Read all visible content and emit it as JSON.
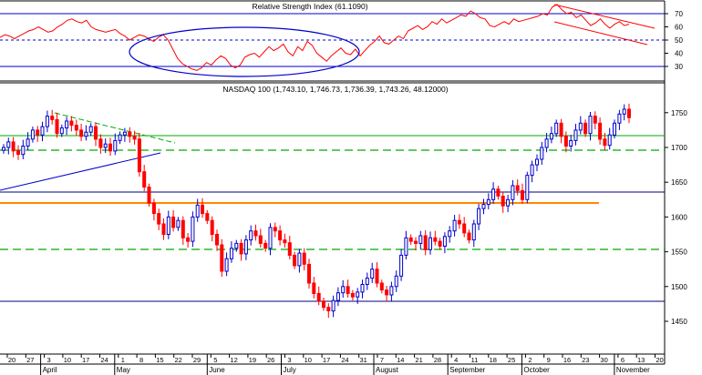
{
  "rsi_panel": {
    "title": "Relative Strength Index (61.1090)",
    "y_ticks": [
      "70",
      "60",
      "50",
      "40",
      "30"
    ],
    "colors": {
      "line": "#ff0000",
      "band": "#0000cc",
      "ellipse": "#0000cc",
      "channel": "#ff0000"
    }
  },
  "price_panel": {
    "title": "NASDAQ 100 (1,743.10, 1,746.73, 1,736.39, 1,743.26, 48.12000)",
    "y_ticks": [
      "1750",
      "1700",
      "1650",
      "1600",
      "1550",
      "1500",
      "1450"
    ],
    "colors": {
      "up_candle": "#0000cc",
      "down_candle": "#ff0000",
      "green_line": "#00aa00",
      "orange_line": "#ff8800",
      "navy_line": "#000080",
      "trendline": "#0000cc"
    }
  },
  "x_axis": {
    "day_labels": [
      "20",
      "27",
      "3",
      "10",
      "17",
      "24",
      "1",
      "8",
      "15",
      "22",
      "29",
      "5",
      "12",
      "19",
      "26",
      "3",
      "10",
      "17",
      "24",
      "31",
      "7",
      "14",
      "21",
      "28",
      "4",
      "11",
      "18",
      "25",
      "2",
      "9",
      "16",
      "23",
      "30",
      "6",
      "13",
      "20"
    ],
    "month_labels": [
      "April",
      "May",
      "June",
      "July",
      "August",
      "September",
      "October",
      "November"
    ]
  },
  "chart_data": [
    {
      "type": "line",
      "title": "Relative Strength Index (61.1090)",
      "last_value": 61.109,
      "ylim": [
        20,
        80
      ],
      "y_ticks": [
        70,
        60,
        50,
        40,
        30
      ],
      "reference_lines": [
        70,
        50,
        30
      ],
      "series": [
        {
          "values": [
            52,
            54,
            53,
            51,
            53,
            55,
            57,
            58,
            60,
            58,
            56,
            57,
            60,
            62,
            65,
            66,
            64,
            63,
            65,
            60,
            58,
            57,
            56,
            57,
            58,
            55,
            53,
            50,
            52,
            54,
            53,
            51,
            49,
            52,
            54,
            50,
            43,
            36,
            32,
            30,
            28,
            27,
            29,
            33,
            31,
            35,
            38,
            36,
            31,
            29,
            31,
            37,
            39,
            40,
            37,
            41,
            45,
            42,
            44,
            47,
            41,
            38,
            45,
            42,
            49,
            46,
            40,
            37,
            34,
            38,
            41,
            44,
            40,
            39,
            43,
            38,
            42,
            46,
            49,
            53,
            48,
            47,
            50,
            53,
            51,
            57,
            59,
            61,
            58,
            60,
            64,
            62,
            66,
            63,
            65,
            67,
            69,
            68,
            72,
            70,
            67,
            66,
            61,
            60,
            62,
            64,
            62,
            66,
            64,
            65,
            66,
            67,
            68,
            70,
            69,
            75,
            77,
            73,
            70,
            71,
            67,
            69,
            65,
            61,
            63,
            66,
            62,
            59,
            62,
            64,
            61,
            62
          ]
        }
      ]
    },
    {
      "type": "candlestick",
      "title": "NASDAQ 100 (1,743.10, 1,746.73, 1,736.39, 1,743.26, 48.12000)",
      "last_bar": {
        "open": 1743.1,
        "high": 1746.73,
        "low": 1736.39,
        "close": 1743.26,
        "volume": 48.12
      },
      "ylim": [
        1430,
        1785
      ],
      "y_ticks": [
        1750,
        1700,
        1650,
        1600,
        1550,
        1500,
        1450
      ],
      "closes": [
        1700,
        1708,
        1695,
        1690,
        1702,
        1712,
        1725,
        1718,
        1730,
        1745,
        1740,
        1720,
        1728,
        1738,
        1732,
        1725,
        1716,
        1722,
        1730,
        1712,
        1700,
        1705,
        1695,
        1710,
        1718,
        1722,
        1716,
        1712,
        1665,
        1643,
        1620,
        1605,
        1590,
        1575,
        1600,
        1585,
        1595,
        1570,
        1565,
        1600,
        1617,
        1605,
        1595,
        1575,
        1560,
        1522,
        1540,
        1555,
        1562,
        1547,
        1567,
        1580,
        1573,
        1562,
        1555,
        1585,
        1580,
        1567,
        1563,
        1545,
        1530,
        1548,
        1532,
        1505,
        1490,
        1479,
        1470,
        1465,
        1480,
        1491,
        1500,
        1490,
        1485,
        1492,
        1503,
        1512,
        1525,
        1505,
        1495,
        1488,
        1500,
        1515,
        1545,
        1570,
        1565,
        1562,
        1573,
        1553,
        1570,
        1565,
        1558,
        1572,
        1580,
        1595,
        1590,
        1577,
        1567,
        1590,
        1612,
        1618,
        1625,
        1640,
        1630,
        1616,
        1625,
        1645,
        1638,
        1625,
        1660,
        1675,
        1683,
        1700,
        1712,
        1720,
        1735,
        1716,
        1702,
        1710,
        1725,
        1735,
        1720,
        1745,
        1735,
        1712,
        1703,
        1718,
        1735,
        1748,
        1755,
        1743
      ]
    }
  ]
}
